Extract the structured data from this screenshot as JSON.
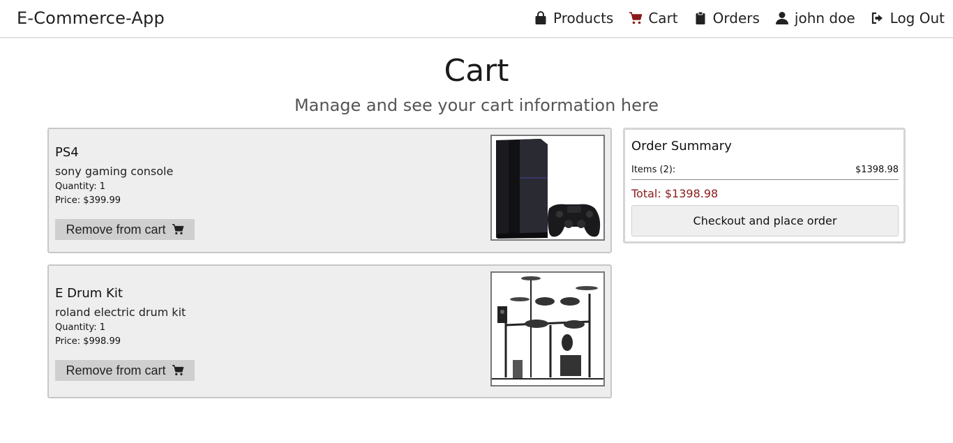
{
  "brand": "E-Commerce-App",
  "nav": {
    "products": "Products",
    "cart": "Cart",
    "orders": "Orders",
    "user": "john doe",
    "logout": "Log Out"
  },
  "colors": {
    "accent": "#8b1a1a",
    "card_bg": "#eeeeee"
  },
  "page": {
    "title": "Cart",
    "subtitle": "Manage and see your cart information here"
  },
  "items": [
    {
      "name": "PS4",
      "description": "sony gaming console",
      "quantity": "Quantity: 1",
      "price": "Price: $399.99",
      "remove_label": "Remove from cart"
    },
    {
      "name": "E Drum Kit",
      "description": "roland electric drum kit",
      "quantity": "Quantity: 1",
      "price": "Price: $998.99",
      "remove_label": "Remove from cart"
    }
  ],
  "summary": {
    "title": "Order Summary",
    "items_label": "Items (2):",
    "items_value": "$1398.98",
    "total": "Total: $1398.98",
    "checkout_label": "Checkout and place order"
  }
}
